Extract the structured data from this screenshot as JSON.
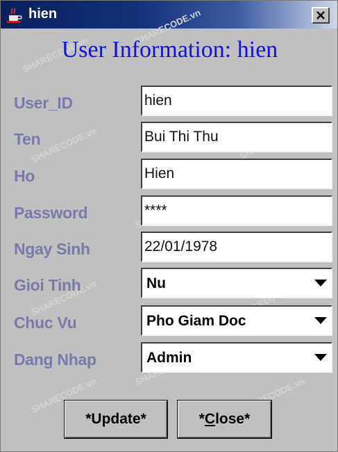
{
  "window": {
    "title": "hien",
    "close_glyph": "X",
    "app_icon": "java-cup-icon"
  },
  "heading": "User Information: hien",
  "fields": [
    {
      "label": "User_ID",
      "value": "hien",
      "type": "text"
    },
    {
      "label": "Ten",
      "value": "Bui Thi Thu",
      "type": "text"
    },
    {
      "label": "Ho",
      "value": "Hien",
      "type": "text"
    },
    {
      "label": "Password",
      "value": "****",
      "type": "password"
    },
    {
      "label": "Ngay Sinh",
      "value": "22/01/1978",
      "type": "text"
    }
  ],
  "selects": [
    {
      "label": "Gioi Tinh",
      "value": "Nu"
    },
    {
      "label": "Chuc Vu",
      "value": "Pho Giam Doc"
    },
    {
      "label": "Dang Nhap",
      "value": "Admin"
    }
  ],
  "buttons": {
    "update_label": "*Update*",
    "close_prefix": "*",
    "close_mnemonic": "C",
    "close_rest": "lose*"
  },
  "watermark": "SHARECODE.vn",
  "colors": {
    "title_bar": "#0a1f5c",
    "heading": "#1010e0",
    "labels": "#7a7aa8",
    "background": "#c0c0c0"
  }
}
